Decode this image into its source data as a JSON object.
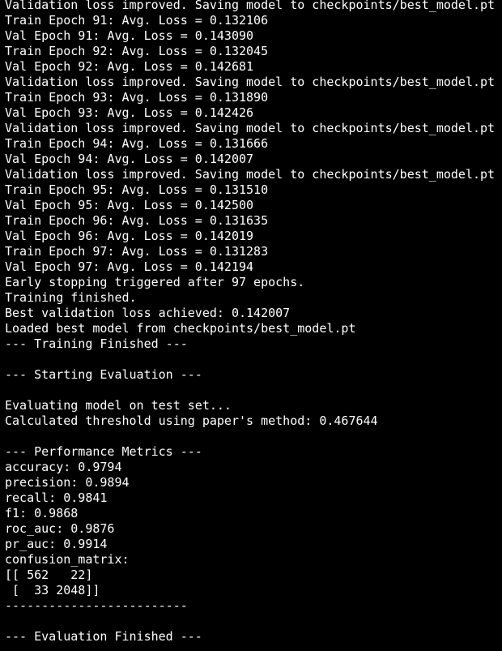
{
  "terminal": {
    "background": "#000000",
    "foreground": "#ffffff",
    "lines": [
      "Validation loss improved. Saving model to checkpoints/best_model.pt",
      "Train Epoch 91: Avg. Loss = 0.132106",
      "Val Epoch 91: Avg. Loss = 0.143090",
      "Train Epoch 92: Avg. Loss = 0.132045",
      "Val Epoch 92: Avg. Loss = 0.142681",
      "Validation loss improved. Saving model to checkpoints/best_model.pt",
      "Train Epoch 93: Avg. Loss = 0.131890",
      "Val Epoch 93: Avg. Loss = 0.142426",
      "Validation loss improved. Saving model to checkpoints/best_model.pt",
      "Train Epoch 94: Avg. Loss = 0.131666",
      "Val Epoch 94: Avg. Loss = 0.142007",
      "Validation loss improved. Saving model to checkpoints/best_model.pt",
      "Train Epoch 95: Avg. Loss = 0.131510",
      "Val Epoch 95: Avg. Loss = 0.142500",
      "Train Epoch 96: Avg. Loss = 0.131635",
      "Val Epoch 96: Avg. Loss = 0.142019",
      "Train Epoch 97: Avg. Loss = 0.131283",
      "Val Epoch 97: Avg. Loss = 0.142194",
      "Early stopping triggered after 97 epochs.",
      "Training finished.",
      "Best validation loss achieved: 0.142007",
      "Loaded best model from checkpoints/best_model.pt",
      "--- Training Finished ---",
      "",
      "--- Starting Evaluation ---",
      "",
      "Evaluating model on test set...",
      "Calculated threshold using paper's method: 0.467644",
      "",
      "--- Performance Metrics ---",
      "accuracy: 0.9794",
      "precision: 0.9894",
      "recall: 0.9841",
      "f1: 0.9868",
      "roc_auc: 0.9876",
      "pr_auc: 0.9914",
      "confusion_matrix:",
      "[[ 562   22]",
      " [  33 2048]]",
      "-------------------------",
      "",
      "--- Evaluation Finished ---"
    ]
  }
}
